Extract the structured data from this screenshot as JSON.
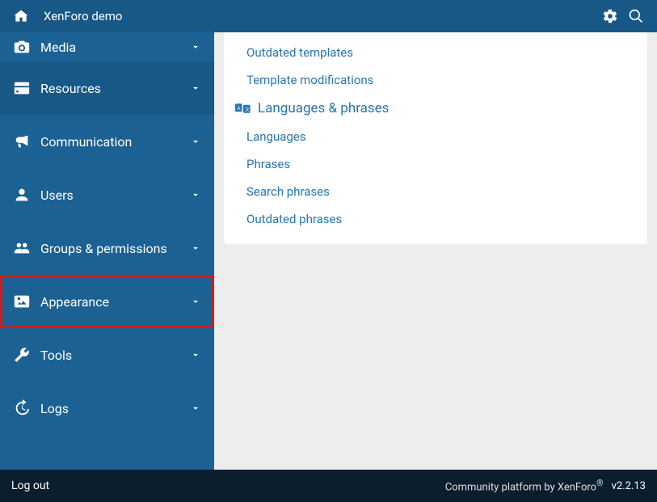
{
  "header": {
    "title": "XenForo demo"
  },
  "sidebar": {
    "items": [
      {
        "label": "Media"
      },
      {
        "label": "Resources"
      },
      {
        "label": "Communication"
      },
      {
        "label": "Users"
      },
      {
        "label": "Groups & permissions"
      },
      {
        "label": "Appearance"
      },
      {
        "label": "Tools"
      },
      {
        "label": "Logs"
      }
    ]
  },
  "main": {
    "top_links": [
      "Outdated templates",
      "Template modifications"
    ],
    "section_heading": "Languages & phrases",
    "section_links": [
      "Languages",
      "Phrases",
      "Search phrases",
      "Outdated phrases"
    ]
  },
  "footer": {
    "logout": "Log out",
    "credit": "Community platform by XenForo",
    "version": "v2.2.13"
  }
}
